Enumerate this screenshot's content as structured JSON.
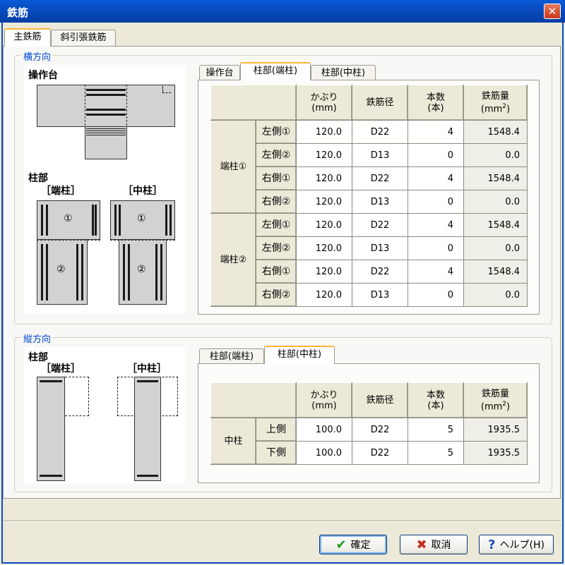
{
  "window": {
    "title": "鉄筋",
    "close_glyph": "✕"
  },
  "main_tabs": [
    {
      "label": "主鉄筋"
    },
    {
      "label": "斜引張鉄筋"
    }
  ],
  "horizontal": {
    "group_label": "横方向",
    "diagram": {
      "top_label": "操作台",
      "bottom_label": "柱部",
      "end_label": "［端柱］",
      "mid_label": "［中柱］",
      "mark1": "①",
      "mark2": "②"
    },
    "tabs": [
      {
        "label": "操作台"
      },
      {
        "label": "柱部(端柱)"
      },
      {
        "label": "柱部(中柱)"
      }
    ],
    "table": {
      "headers": {
        "cover": "かぶり",
        "cover_unit": "(mm)",
        "dia": "鉄筋径",
        "count": "本数",
        "count_unit": "(本)",
        "amount": "鉄筋量",
        "amount_unit": "(mm",
        "amount_sup": "2",
        "amount_close": ")"
      },
      "groups": [
        {
          "name": "端柱①",
          "rows": [
            {
              "side": "左側①",
              "cover": "120.0",
              "dia": "D22",
              "count": "4",
              "amount": "1548.4"
            },
            {
              "side": "左側②",
              "cover": "120.0",
              "dia": "D13",
              "count": "0",
              "amount": "0.0"
            },
            {
              "side": "右側①",
              "cover": "120.0",
              "dia": "D22",
              "count": "4",
              "amount": "1548.4"
            },
            {
              "side": "右側②",
              "cover": "120.0",
              "dia": "D13",
              "count": "0",
              "amount": "0.0"
            }
          ]
        },
        {
          "name": "端柱②",
          "rows": [
            {
              "side": "左側①",
              "cover": "120.0",
              "dia": "D22",
              "count": "4",
              "amount": "1548.4"
            },
            {
              "side": "左側②",
              "cover": "120.0",
              "dia": "D13",
              "count": "0",
              "amount": "0.0"
            },
            {
              "side": "右側①",
              "cover": "120.0",
              "dia": "D22",
              "count": "4",
              "amount": "1548.4"
            },
            {
              "side": "右側②",
              "cover": "120.0",
              "dia": "D13",
              "count": "0",
              "amount": "0.0"
            }
          ]
        }
      ]
    }
  },
  "vertical": {
    "group_label": "縦方向",
    "diagram": {
      "top_label": "柱部",
      "end_label": "［端柱］",
      "mid_label": "［中柱］"
    },
    "tabs": [
      {
        "label": "柱部(端柱)"
      },
      {
        "label": "柱部(中柱)"
      }
    ],
    "table": {
      "group": "中柱",
      "rows": [
        {
          "side": "上側",
          "cover": "100.0",
          "dia": "D22",
          "count": "5",
          "amount": "1935.5"
        },
        {
          "side": "下側",
          "cover": "100.0",
          "dia": "D22",
          "count": "5",
          "amount": "1935.5"
        }
      ]
    }
  },
  "buttons": {
    "ok": {
      "label": "確定",
      "icon": "check-icon",
      "glyph": "✔",
      "color": "#1e9a1e"
    },
    "cancel": {
      "label": "取消",
      "icon": "x-icon",
      "glyph": "✖",
      "color": "#c8281e"
    },
    "help": {
      "label": "ヘルプ(H)",
      "icon": "question-icon",
      "glyph": "?",
      "color": "#1a4fb3"
    }
  }
}
